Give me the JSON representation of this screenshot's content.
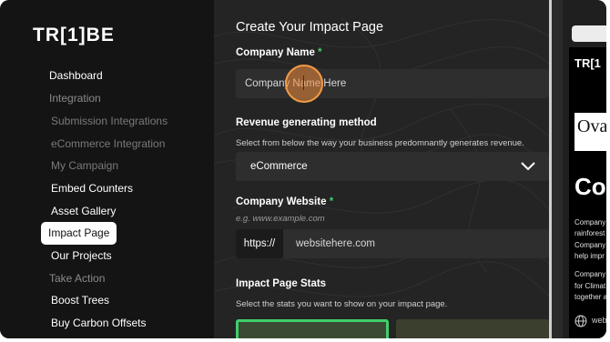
{
  "sidebar": {
    "logo": "TR[1]BE",
    "items": [
      {
        "label": "Dashboard"
      },
      {
        "label": "Integration"
      },
      {
        "label": "Submission Integrations"
      },
      {
        "label": "eCommerce Integration"
      },
      {
        "label": "My Campaign"
      },
      {
        "label": "Embed Counters"
      },
      {
        "label": "Asset Gallery"
      },
      {
        "label": "Impact Page"
      },
      {
        "label": "Our Projects"
      },
      {
        "label": "Take Action"
      },
      {
        "label": "Boost Trees"
      },
      {
        "label": "Buy Carbon Offsets"
      }
    ]
  },
  "main": {
    "title": "Create Your Impact Page",
    "company_name": {
      "label": "Company Name",
      "required_mark": "*",
      "value": "Company Name Here"
    },
    "revenue": {
      "label": "Revenue generating method",
      "help": "Select from below the way your business predomnantly generates revenue.",
      "selected": "eCommerce"
    },
    "website": {
      "label": "Company Website",
      "required_mark": "*",
      "example": "e.g. www.example.com",
      "prefix": "https://",
      "value": "websitehere.com"
    },
    "stats": {
      "label": "Impact Page Stats",
      "help": "Select the stats you want to show on your impact page."
    }
  },
  "preview": {
    "logo": "TR[1",
    "badge": "Ova",
    "heading": "Co",
    "lines": [
      "Company",
      "rainforest",
      "Company",
      "help impr",
      "Company",
      "for Climat",
      "together a"
    ],
    "web_label": "web"
  },
  "colors": {
    "accent_green": "#3fcf6a",
    "cursor_orange": "#f29b47",
    "sidebar_bg": "#141414",
    "main_bg": "#242424"
  }
}
